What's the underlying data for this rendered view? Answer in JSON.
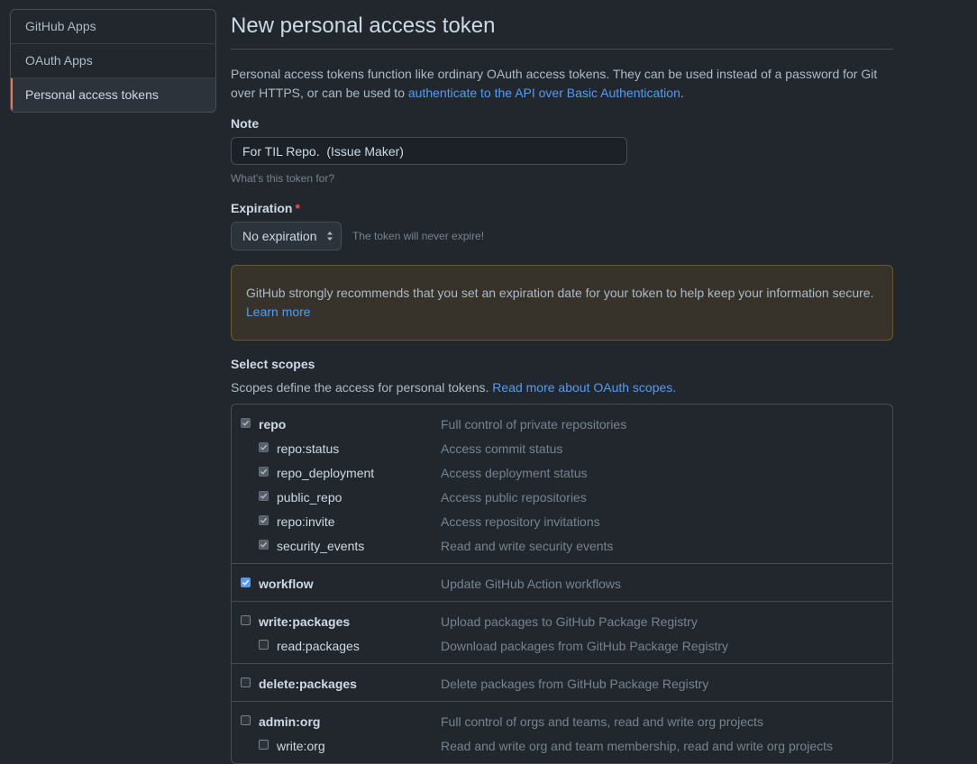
{
  "sidebar": {
    "items": [
      {
        "label": "GitHub Apps"
      },
      {
        "label": "OAuth Apps"
      },
      {
        "label": "Personal access tokens"
      }
    ]
  },
  "page": {
    "title": "New personal access token",
    "intro_text": "Personal access tokens function like ordinary OAuth access tokens. They can be used instead of a password for Git over HTTPS, or can be used to ",
    "intro_link": "authenticate to the API over Basic Authentication",
    "intro_end": "."
  },
  "note": {
    "label": "Note",
    "value": "For TIL Repo.  (Issue Maker)",
    "hint": "What's this token for?"
  },
  "expiration": {
    "label": "Expiration",
    "required_mark": "*",
    "selected": "No expiration",
    "note": "The token will never expire!"
  },
  "warning": {
    "text": "GitHub strongly recommends that you set an expiration date for your token to help keep your information secure. ",
    "link": "Learn more"
  },
  "scopes": {
    "label": "Select scopes",
    "desc": "Scopes define the access for personal tokens. ",
    "link": "Read more about OAuth scopes.",
    "groups": [
      {
        "name": "repo",
        "desc": "Full control of private repositories",
        "children": [
          {
            "name": "repo:status",
            "desc": "Access commit status"
          },
          {
            "name": "repo_deployment",
            "desc": "Access deployment status"
          },
          {
            "name": "public_repo",
            "desc": "Access public repositories"
          },
          {
            "name": "repo:invite",
            "desc": "Access repository invitations"
          },
          {
            "name": "security_events",
            "desc": "Read and write security events"
          }
        ]
      },
      {
        "name": "workflow",
        "desc": "Update GitHub Action workflows"
      },
      {
        "name": "write:packages",
        "desc": "Upload packages to GitHub Package Registry",
        "children": [
          {
            "name": "read:packages",
            "desc": "Download packages from GitHub Package Registry"
          }
        ]
      },
      {
        "name": "delete:packages",
        "desc": "Delete packages from GitHub Package Registry"
      },
      {
        "name": "admin:org",
        "desc": "Full control of orgs and teams, read and write org projects",
        "children": [
          {
            "name": "write:org",
            "desc": "Read and write org and team membership, read and write org projects"
          }
        ]
      }
    ]
  },
  "colors": {
    "background": "#22272e",
    "link": "#539bf5",
    "accent_selected": "#ec775c",
    "warning_bg": "#37332a"
  }
}
